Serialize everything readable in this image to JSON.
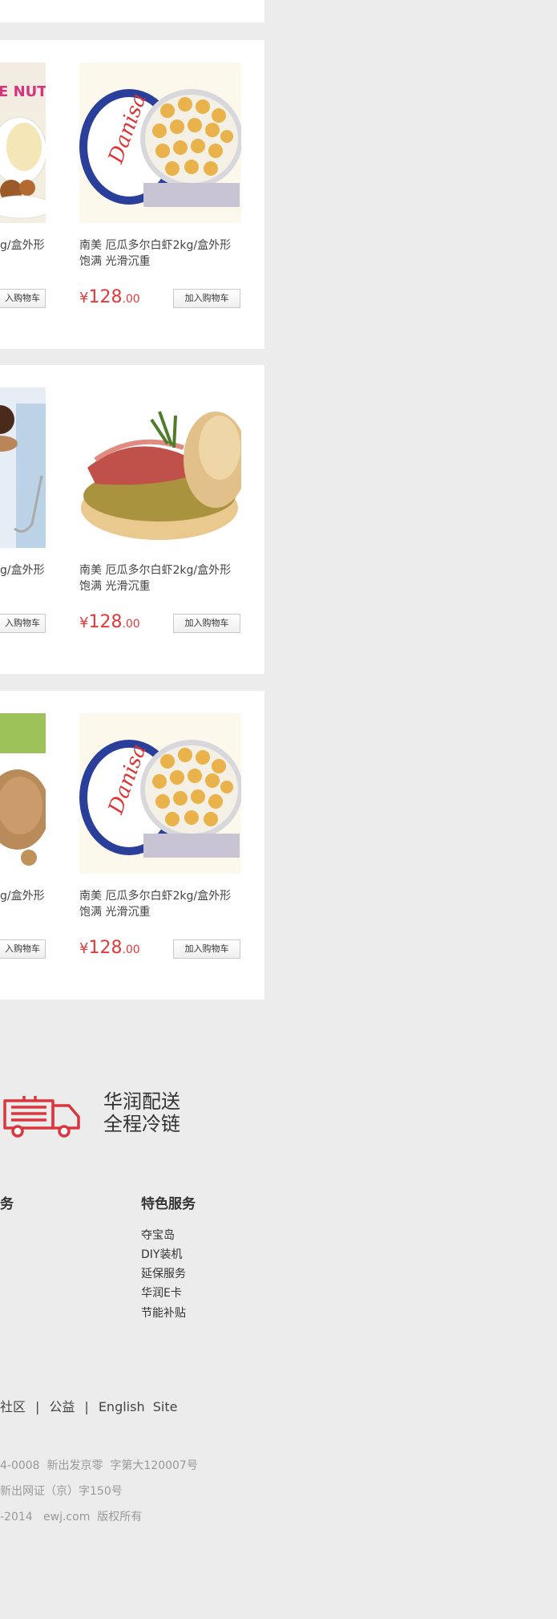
{
  "products": [
    {
      "title": "南美 厄瓜多尔白虾2kg/盒外形\n饱满 光滑沉重",
      "price_yen": "¥",
      "price_int": "128",
      "price_dec": ".00",
      "cart_label": "加入购物车",
      "image": "cookie-tin"
    },
    {
      "title": "南美 厄瓜多尔白虾2kg/盒外形\n饱满 光滑沉重",
      "price_yen": "¥",
      "price_int": "128",
      "price_dec": ".00",
      "cart_label": "加入购物车",
      "image": "ham-sandwich"
    },
    {
      "title": "南美 厄瓜多尔白虾2kg/盒外形\n饱满 光滑沉重",
      "price_yen": "¥",
      "price_int": "128",
      "price_dec": ".00",
      "cart_label": "加入购物车",
      "image": "cookie-tin"
    }
  ],
  "left_partial": {
    "title_fragment": "g/盒外形",
    "cart_fragment": "入购物车",
    "nut_text": "E NUT"
  },
  "delivery": {
    "line1": "华润配送",
    "line2": "全程冷链",
    "icon": "truck-icon"
  },
  "footer": {
    "left_heading_fragment": "务",
    "special_heading": "特色服务",
    "special_items": [
      "夺宝岛",
      "DIY装机",
      "延保服务",
      "华润E卡",
      "节能补贴"
    ],
    "links": [
      "社区",
      "公益",
      "English  Site"
    ],
    "copyright": [
      "4-0008  新出发京零  字第大120007号",
      "新出网证（京）字150号",
      "-2014   ewj.com  版权所有"
    ]
  },
  "colors": {
    "price": "#e23a3a",
    "accent": "#d9363e",
    "background": "#ececec"
  }
}
